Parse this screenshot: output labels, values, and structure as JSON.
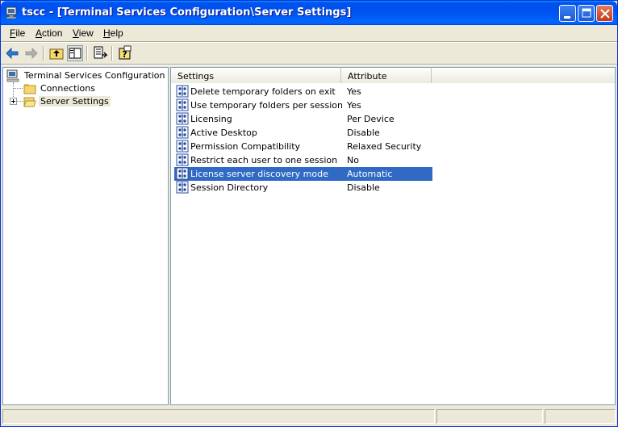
{
  "window": {
    "title": "tscc - [Terminal Services Configuration\\Server Settings]",
    "title_color": "#ffffff",
    "titlebar_color": "#0053ee"
  },
  "menu": {
    "items": [
      {
        "label": "File",
        "accel": "F",
        "rest": "ile"
      },
      {
        "label": "Action",
        "accel": "A",
        "rest": "ction"
      },
      {
        "label": "View",
        "accel": "V",
        "rest": "iew"
      },
      {
        "label": "Help",
        "accel": "H",
        "rest": "elp"
      }
    ]
  },
  "toolbar": {
    "icons": [
      "back-arrow-icon",
      "forward-arrow-icon",
      "up-one-level-icon",
      "show-hide-tree-icon",
      "export-list-icon",
      "help-icon"
    ]
  },
  "tree": {
    "root": "Terminal Services Configuration",
    "children": [
      {
        "label": "Connections",
        "expander": false,
        "selected": false
      },
      {
        "label": "Server Settings",
        "expander": true,
        "selected": true
      }
    ]
  },
  "list": {
    "columns": [
      "Settings",
      "Attribute"
    ],
    "rows": [
      {
        "setting": "Delete temporary folders on exit",
        "attribute": "Yes",
        "selected": false
      },
      {
        "setting": "Use temporary folders per session",
        "attribute": "Yes",
        "selected": false
      },
      {
        "setting": "Licensing",
        "attribute": "Per Device",
        "selected": false
      },
      {
        "setting": "Active Desktop",
        "attribute": "Disable",
        "selected": false
      },
      {
        "setting": "Permission Compatibility",
        "attribute": "Relaxed Security",
        "selected": false
      },
      {
        "setting": "Restrict each user to one session",
        "attribute": "No",
        "selected": false
      },
      {
        "setting": "License server discovery mode",
        "attribute": "Automatic",
        "selected": true
      },
      {
        "setting": "Session Directory",
        "attribute": "Disable",
        "selected": false
      }
    ],
    "selection_color": "#316ac5"
  }
}
